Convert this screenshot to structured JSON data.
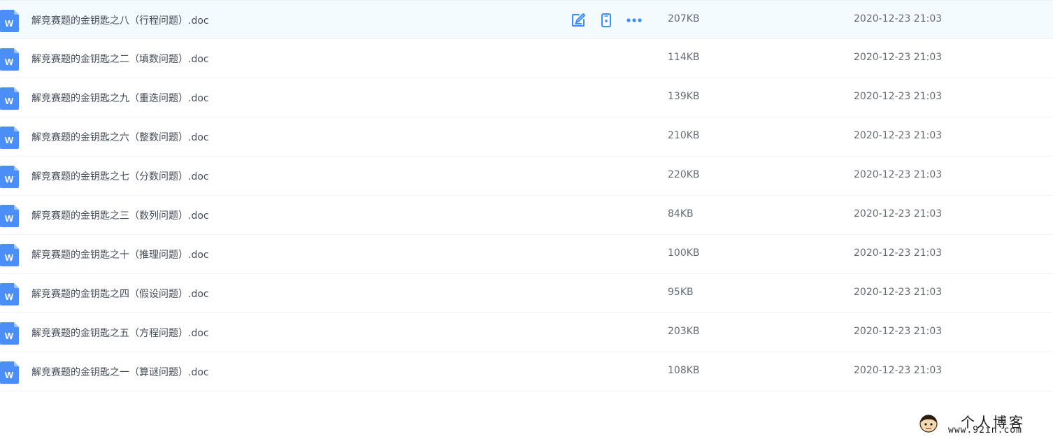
{
  "files": [
    {
      "name": "解竞赛题的金钥匙之八（行程问题）.doc",
      "size": "207KB",
      "modified": "2020-12-23 21:03",
      "icon": "word-doc-icon"
    },
    {
      "name": "解竞赛题的金钥匙之二（填数问题）.doc",
      "size": "114KB",
      "modified": "2020-12-23 21:03",
      "icon": "word-doc-icon"
    },
    {
      "name": "解竞赛题的金钥匙之九（重迭问题）.doc",
      "size": "139KB",
      "modified": "2020-12-23 21:03",
      "icon": "word-doc-icon"
    },
    {
      "name": "解竞赛题的金钥匙之六（整数问题）.doc",
      "size": "210KB",
      "modified": "2020-12-23 21:03",
      "icon": "word-doc-icon"
    },
    {
      "name": "解竞赛题的金钥匙之七（分数问题）.doc",
      "size": "220KB",
      "modified": "2020-12-23 21:03",
      "icon": "word-doc-icon"
    },
    {
      "name": "解竞赛题的金钥匙之三（数列问题）.doc",
      "size": "84KB",
      "modified": "2020-12-23 21:03",
      "icon": "word-doc-icon"
    },
    {
      "name": "解竞赛题的金钥匙之十（推理问题）.doc",
      "size": "100KB",
      "modified": "2020-12-23 21:03",
      "icon": "word-doc-icon"
    },
    {
      "name": "解竞赛题的金钥匙之四（假设问题）.doc",
      "size": "95KB",
      "modified": "2020-12-23 21:03",
      "icon": "word-doc-icon"
    },
    {
      "name": "解竞赛题的金钥匙之五（方程问题）.doc",
      "size": "203KB",
      "modified": "2020-12-23 21:03",
      "icon": "word-doc-icon"
    },
    {
      "name": "解竞赛题的金钥匙之一（算谜问题）.doc",
      "size": "108KB",
      "modified": "2020-12-23 21:03",
      "icon": "word-doc-icon"
    }
  ],
  "hovered_row_actions": [
    "edit-icon",
    "phone-icon",
    "more-icon"
  ],
  "watermark": {
    "title": "个人博客",
    "url": "www.92in.com"
  },
  "colors": {
    "accent": "#3b8cff",
    "doc_icon": "#4b8ef7",
    "hover_bg": "#f4fbff"
  }
}
